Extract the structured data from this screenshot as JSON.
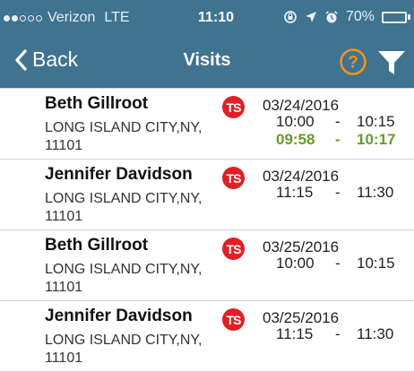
{
  "status_bar": {
    "carrier": "Verizon",
    "network": "LTE",
    "time": "11:10",
    "battery_percent": "70%",
    "battery_level": 0.7,
    "icons": [
      "signal-dots-icon",
      "orientation-lock-icon",
      "location-arrow-icon",
      "alarm-icon",
      "battery-icon"
    ]
  },
  "nav": {
    "back_label": "Back",
    "title": "Visits",
    "help_icon": "question-circle-icon",
    "filter_icon": "filter-funnel-icon",
    "accent_color": "#f0921e",
    "bar_color": "#3f7390"
  },
  "visits": [
    {
      "name": "Beth Gillroot",
      "address": "LONG ISLAND CITY,NY, 11101",
      "badge": "TS",
      "date": "03/24/2016",
      "start": "10:00",
      "end": "10:15",
      "actual_start": "09:58",
      "actual_end": "10:17"
    },
    {
      "name": "Jennifer Davidson",
      "address": "LONG ISLAND CITY,NY, 11101",
      "badge": "TS",
      "date": "03/24/2016",
      "start": "11:15",
      "end": "11:30"
    },
    {
      "name": "Beth Gillroot",
      "address": "LONG ISLAND CITY,NY, 11101",
      "badge": "TS",
      "date": "03/25/2016",
      "start": "10:00",
      "end": "10:15"
    },
    {
      "name": "Jennifer Davidson",
      "address": "LONG ISLAND CITY,NY, 11101",
      "badge": "TS",
      "date": "03/25/2016",
      "start": "11:15",
      "end": "11:30"
    }
  ],
  "time_separator": "-"
}
